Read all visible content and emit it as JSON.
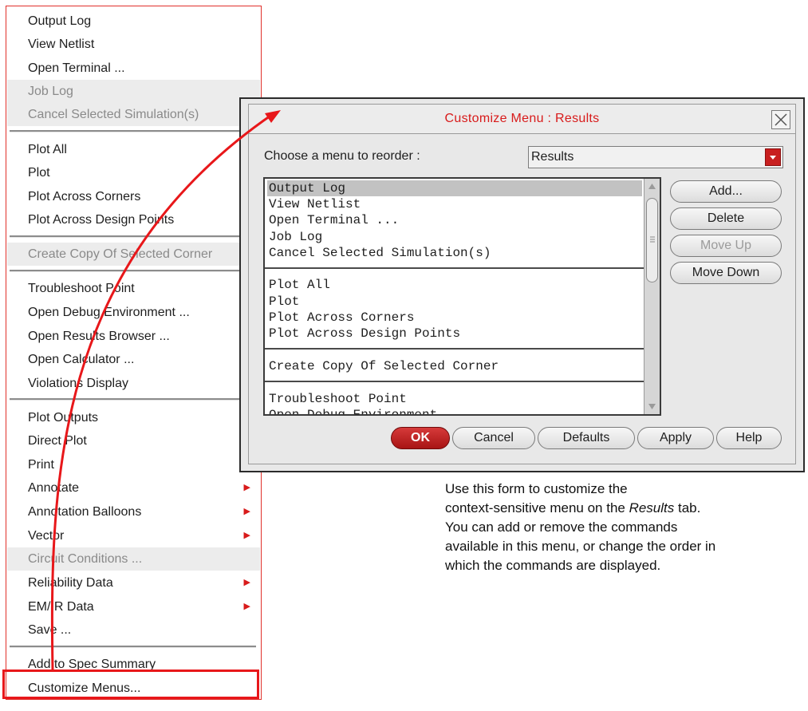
{
  "context_menu": {
    "items": [
      {
        "label": "Output Log",
        "mnemonic": "L",
        "disabled": false
      },
      {
        "label": "View Netlist",
        "mnemonic": "V",
        "disabled": false
      },
      {
        "label": "Open Terminal ...",
        "disabled": false
      },
      {
        "label": "Job Log",
        "mnemonic": "J",
        "disabled": true
      },
      {
        "label": "Cancel Selected Simulation(s)",
        "mnemonic": "C",
        "disabled": true
      },
      {
        "label": "Plot All",
        "mnemonic": "P",
        "disabled": false
      },
      {
        "label": "Plot",
        "disabled": false
      },
      {
        "label": "Plot Across Corners",
        "disabled": false
      },
      {
        "label": "Plot Across Design Points",
        "disabled": false
      },
      {
        "label": "Create Copy Of Selected Corner",
        "disabled": true
      },
      {
        "label": "Troubleshoot Point",
        "disabled": false
      },
      {
        "label": "Open Debug Environment ...",
        "disabled": false
      },
      {
        "label": "Open Results Browser ...",
        "disabled": false
      },
      {
        "label": "Open Calculator ...",
        "disabled": false
      },
      {
        "label": "Violations Display",
        "mnemonic": "V",
        "disabled": false
      },
      {
        "label": "Plot Outputs",
        "mnemonic": "u",
        "disabled": false
      },
      {
        "label": "Direct Plot",
        "mnemonic": "P",
        "disabled": false
      },
      {
        "label": "Print",
        "mnemonic": "i",
        "disabled": false
      },
      {
        "label": "Annotate",
        "mnemonic": "A",
        "disabled": false,
        "submenu": true
      },
      {
        "label": "Annotation Balloons",
        "mnemonic": "B",
        "disabled": false,
        "submenu": true
      },
      {
        "label": "Vector",
        "mnemonic": "t",
        "disabled": false,
        "submenu": true
      },
      {
        "label": "Circuit Conditions ...",
        "mnemonic": "C",
        "disabled": true
      },
      {
        "label": "Reliability Data",
        "disabled": false,
        "submenu": true
      },
      {
        "label": "EM/IR Data",
        "mnemonic": "M",
        "disabled": false,
        "submenu": true
      },
      {
        "label": "Save ...",
        "mnemonic": "S",
        "disabled": false
      },
      {
        "label": "Add to Spec Summary",
        "disabled": false
      },
      {
        "label": "Customize Menus...",
        "disabled": false
      }
    ]
  },
  "dialog": {
    "title": "Customize Menu  :  Results",
    "choose_label": "Choose a menu to reorder :",
    "selected_menu": "Results",
    "list_items": [
      "Output Log",
      "View Netlist",
      "Open Terminal ...",
      "Job Log",
      "Cancel Selected Simulation(s)",
      "Plot All",
      "Plot",
      "Plot Across Corners",
      "Plot Across Design Points",
      "Create Copy Of Selected Corner",
      "Troubleshoot Point",
      "Open Debug Environment"
    ],
    "side_buttons": {
      "add": "Add...",
      "delete": "Delete",
      "move_up": "Move Up",
      "move_down": "Move Down"
    },
    "buttons": {
      "ok": "OK",
      "cancel": "Cancel",
      "defaults": "Defaults",
      "apply": "Apply",
      "help": "Help"
    }
  },
  "description": {
    "line1": "Use this form to customize the",
    "line2_pre": "context-sensitive menu on the ",
    "line2_em": "Results",
    "line2_post": " tab.",
    "line3": "You can add or remove the commands",
    "line4": "available in this menu, or change the order in",
    "line5": "which the commands are displayed."
  },
  "colors": {
    "accent_red": "#d81b1b",
    "highlight_red": "#e8171a"
  }
}
